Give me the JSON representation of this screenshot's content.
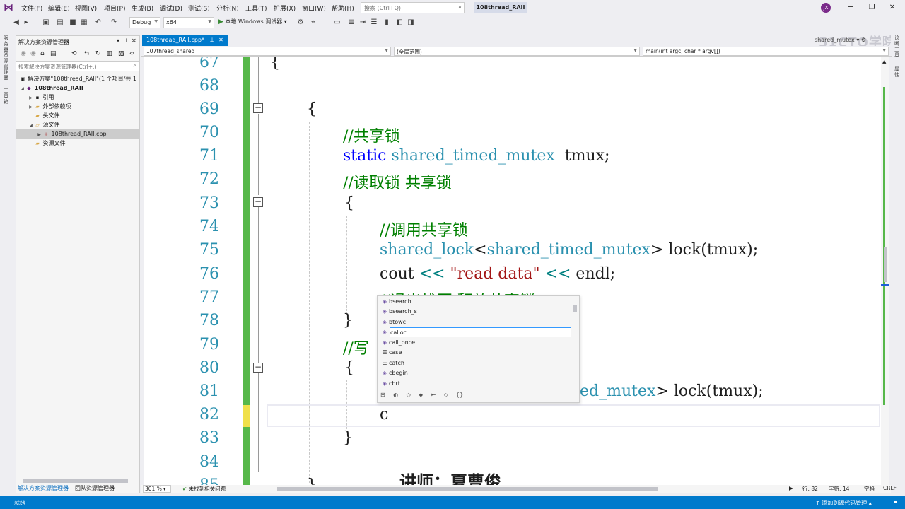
{
  "menu": {
    "items": [
      "文件(F)",
      "编辑(E)",
      "视图(V)",
      "项目(P)",
      "生成(B)",
      "调试(D)",
      "测试(S)",
      "分析(N)",
      "工具(T)",
      "扩展(X)",
      "窗口(W)",
      "帮助(H)"
    ],
    "search_placeholder": "搜索 (Ctrl+Q)",
    "solution_title": "108thread_RAII",
    "avatar_initials": "JX"
  },
  "toolbar": {
    "config": "Debug",
    "platform": "x64",
    "run_label": "本地 Windows 调试器",
    "watermark": "51CTO学院"
  },
  "left_rail": {
    "item1": "服务器资源管理器",
    "item2": "工具箱"
  },
  "right_rail": {
    "item1": "诊断工具",
    "item2": "属性"
  },
  "solution_explorer": {
    "title": "解决方案资源管理器",
    "search_placeholder": "搜索解决方案资源管理器(Ctrl+;)",
    "items": [
      {
        "label": "解决方案\"108thread_RAII\"(1 个项目/共 1"
      },
      {
        "label": "108thread_RAII"
      },
      {
        "label": "引用"
      },
      {
        "label": "外部依赖项"
      },
      {
        "label": "头文件"
      },
      {
        "label": "源文件"
      },
      {
        "label": "108thread_RAII.cpp"
      },
      {
        "label": "资源文件"
      }
    ],
    "tab_active": "解决方案资源管理器",
    "tab_other": "团队资源管理器"
  },
  "editor": {
    "tab_label": "108thread_RAII.cpp*",
    "side_tab": "shared_mutex",
    "nav_project": "107thread_shared",
    "nav_scope": "(全局范围)",
    "nav_function": "main(int argc, char * argv[])",
    "zoom": "301 %",
    "issues": "未找到相关问题",
    "line_pos": "行: 82",
    "col_pos": "字符: 14",
    "space_mode": "空格",
    "line_ending": "CRLF"
  },
  "code": {
    "line_numbers": [
      "67",
      "68",
      "69",
      "70",
      "71",
      "72",
      "73",
      "74",
      "75",
      "76",
      "77",
      "78",
      "79",
      "80",
      "81",
      "82",
      "83",
      "84",
      "85"
    ],
    "l67": "{",
    "l69": "{",
    "l70": "//共享锁",
    "l71_kw": "static",
    "l71_ty": "shared_timed_mutex",
    "l71_rest": "  tmux;",
    "l72": "//读取锁 共享锁",
    "l73": "{",
    "l74": "//调用共享锁",
    "l75_ty1": "shared_lock",
    "l75_lt": "<",
    "l75_ty2": "shared_timed_mutex",
    "l75_rest": "> lock(tmux);",
    "l76_a": "cout ",
    "l76_op": "<<",
    "l76_str": " \"read data\" ",
    "l76_op2": "<<",
    "l76_b": " endl;",
    "l77": "//退出栈区 释放共享锁",
    "l78": "}",
    "l79": "//写",
    "l80": "{",
    "l81_ty": "ed_mutex",
    "l81_rest": "> lock(tmux);",
    "l82": "c",
    "l83": "}",
    "l84": "",
    "l85": "}"
  },
  "intellisense": {
    "items": [
      "bsearch",
      "bsearch_s",
      "btowc",
      "calloc",
      "call_once",
      "case",
      "catch",
      "cbegin",
      "cbrt"
    ],
    "selected": "calloc"
  },
  "subtitle": "讲师：夏曹俊",
  "statusbar": {
    "ready": "就绪",
    "source_control": "添加到源代码管理"
  }
}
